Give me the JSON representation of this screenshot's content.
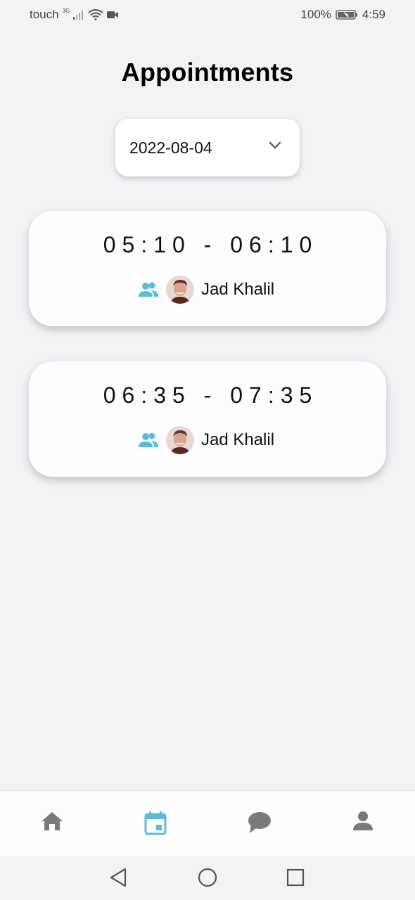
{
  "status_bar": {
    "carrier": "touch",
    "network": "3G",
    "battery": "100%",
    "time": "4:59"
  },
  "page": {
    "title": "Appointments"
  },
  "date_picker": {
    "selected": "2022-08-04"
  },
  "appointments": [
    {
      "time_range": "05:10 - 06:10",
      "person": "Jad Khalil"
    },
    {
      "time_range": "06:35 - 07:35",
      "person": "Jad Khalil"
    }
  ],
  "colors": {
    "accent": "#5bbcd8",
    "nav_inactive": "#7a7a7a",
    "background": "#f3f2f5"
  },
  "bottom_nav": {
    "items": [
      "home-icon",
      "calendar-icon",
      "chat-icon",
      "profile-icon"
    ],
    "active": "calendar-icon"
  }
}
